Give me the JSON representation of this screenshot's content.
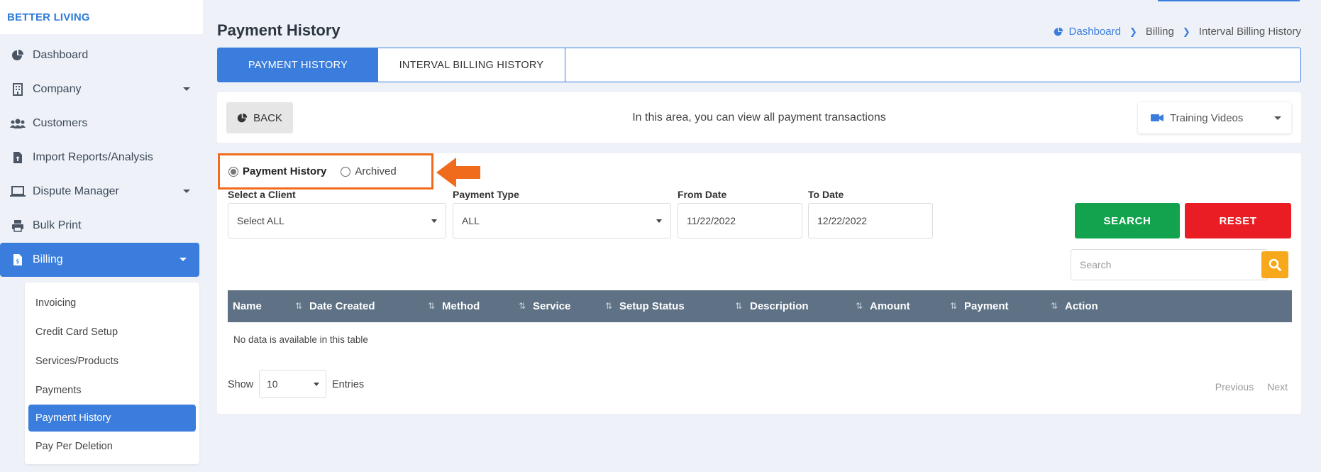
{
  "app": {
    "brand": "BETTER LIVING"
  },
  "sidebar": {
    "items": [
      {
        "label": "Dashboard",
        "icon": "pie-chart-icon"
      },
      {
        "label": "Company",
        "icon": "building-icon",
        "has_submenu": true
      },
      {
        "label": "Customers",
        "icon": "users-icon"
      },
      {
        "label": "Import Reports/Analysis",
        "icon": "file-import-icon"
      },
      {
        "label": "Dispute Manager",
        "icon": "laptop-icon",
        "has_submenu": true
      },
      {
        "label": "Bulk Print",
        "icon": "printer-icon"
      },
      {
        "label": "Billing",
        "icon": "invoice-icon",
        "has_submenu": true,
        "active": true
      }
    ],
    "billing_submenu": [
      {
        "label": "Invoicing"
      },
      {
        "label": "Credit Card Setup"
      },
      {
        "label": "Services/Products"
      },
      {
        "label": "Payments"
      },
      {
        "label": "Payment History",
        "active": true
      },
      {
        "label": "Pay Per Deletion"
      }
    ]
  },
  "header": {
    "title": "Payment History",
    "breadcrumb": [
      "Dashboard",
      "Billing",
      "Interval Billing History"
    ]
  },
  "tabs": [
    {
      "label": "PAYMENT HISTORY",
      "active": true
    },
    {
      "label": "INTERVAL BILLING HISTORY",
      "active": false
    }
  ],
  "infobar": {
    "back_label": "BACK",
    "message": "In this area, you can view all payment transactions",
    "training_label": "Training Videos"
  },
  "filters": {
    "radio_options": [
      {
        "label": "Payment History",
        "checked": true
      },
      {
        "label": "Archived",
        "checked": false
      }
    ],
    "client_label": "Select a Client",
    "client_value": "Select ALL",
    "payment_type_label": "Payment Type",
    "payment_type_value": "ALL",
    "from_date_label": "From Date",
    "from_date_value": "11/22/2022",
    "to_date_label": "To Date",
    "to_date_value": "12/22/2022",
    "search_button": "SEARCH",
    "reset_button": "RESET"
  },
  "table": {
    "search_placeholder": "Search",
    "columns": [
      "Name",
      "Date Created",
      "Method",
      "Service",
      "Setup Status",
      "Description",
      "Amount",
      "Payment",
      "Action"
    ],
    "empty_message": "No data is available in this table",
    "show_label": "Show",
    "page_size": "10",
    "entries_label": "Entries",
    "previous": "Previous",
    "next": "Next"
  },
  "colors": {
    "primary": "#3b7ddd",
    "highlight": "#f06b1c",
    "search_green": "#13a34f",
    "reset_red": "#ea1c24",
    "table_header": "#5e7185",
    "search_yellow": "#f7a81b"
  }
}
